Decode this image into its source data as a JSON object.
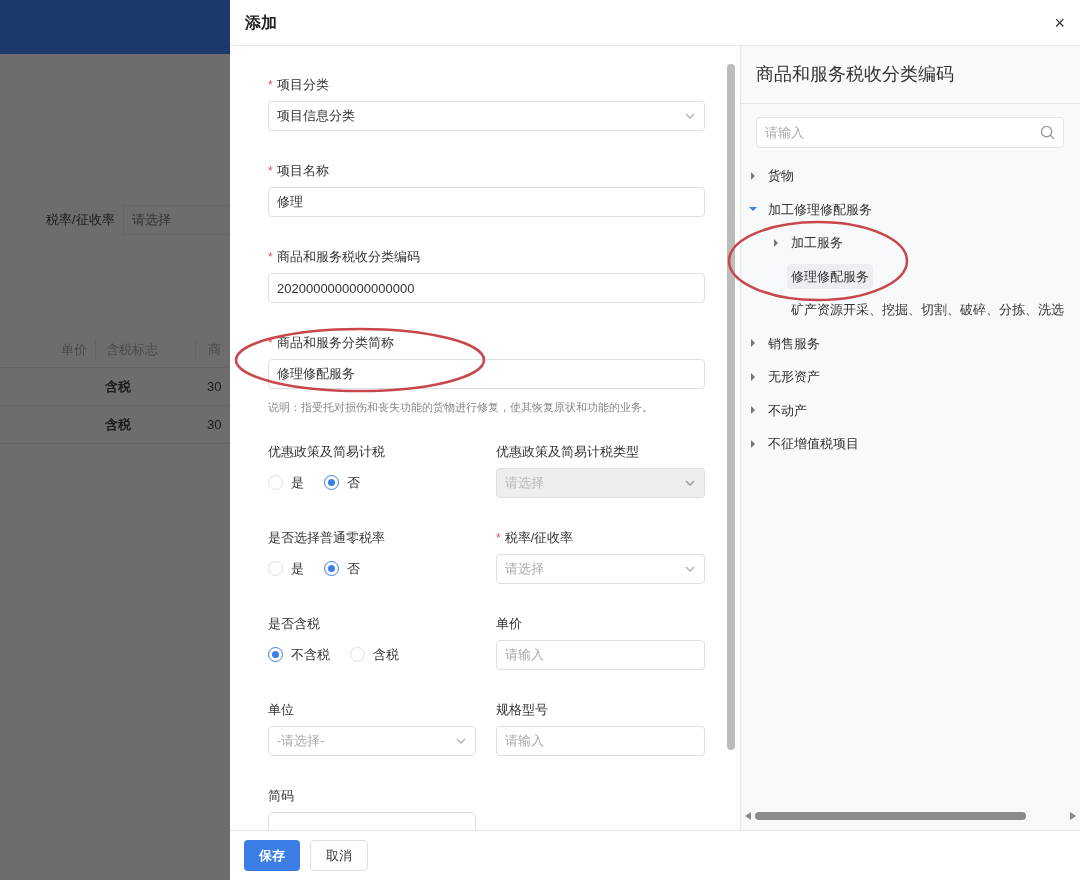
{
  "background_page": {
    "filter": {
      "label": "税率/征收率",
      "placeholder": "请选择"
    },
    "table": {
      "columns": [
        "单价",
        "含税标志",
        "商"
      ],
      "rows": [
        {
          "tax_flag": "含税",
          "column_3": "30"
        },
        {
          "tax_flag": "含税",
          "column_3": "30"
        }
      ]
    }
  },
  "dialog": {
    "title": "添加",
    "close": "×",
    "form": {
      "fields": [
        {
          "kind": "select",
          "label": "项目分类",
          "required_mark": "*",
          "value": "项目信息分类"
        },
        {
          "kind": "input",
          "label": "项目名称",
          "required_mark": "*",
          "value": "修理"
        },
        {
          "kind": "input",
          "label": "商品和服务税收分类编码",
          "required_mark": "*",
          "value": "2020000000000000000"
        },
        {
          "kind": "input",
          "label": "商品和服务分类简称",
          "required_mark": "*",
          "value": "修理修配服务",
          "hint": "说明：指受托对损伤和丧失功能的货物进行修复，使其恢复原状和功能的业务。"
        }
      ],
      "grid": [
        {
          "kind": "radio",
          "label": "优惠政策及简易计税",
          "options": [
            {
              "label": "是",
              "selected": false
            },
            {
              "label": "否",
              "selected": true
            }
          ]
        },
        {
          "kind": "select",
          "label": "优惠政策及简易计税类型",
          "placeholder": "请选择",
          "disabled": true
        },
        {
          "kind": "radio",
          "label": "是否选择普通零税率",
          "options": [
            {
              "label": "是",
              "selected": false
            },
            {
              "label": "否",
              "selected": true
            }
          ]
        },
        {
          "kind": "select",
          "label": "税率/征收率",
          "required_mark": "*",
          "placeholder": "请选择",
          "disabled": false
        },
        {
          "kind": "radio",
          "label": "是否含税",
          "options": [
            {
              "label": "不含税",
              "selected": true
            },
            {
              "label": "含税",
              "selected": false
            }
          ]
        },
        {
          "kind": "input",
          "label": "单价",
          "placeholder": "请输入"
        },
        {
          "kind": "select",
          "label": "单位",
          "placeholder": "-请选择-",
          "disabled": false
        },
        {
          "kind": "input",
          "label": "规格型号",
          "placeholder": "请输入"
        },
        {
          "kind": "input",
          "label": "简码"
        }
      ]
    },
    "tax_code_panel": {
      "title": "商品和服务税收分类编码",
      "search": {
        "placeholder": "请输入"
      },
      "tree": [
        {
          "label": "货物",
          "expanded": false,
          "selected": false
        },
        {
          "label": "加工修理修配服务",
          "expanded": true,
          "selected": false,
          "children": [
            {
              "label": "加工服务",
              "expanded": false,
              "selected": false
            },
            {
              "label": "修理修配服务",
              "selected": true
            },
            {
              "label": "矿产资源开采、挖掘、切割、破碎、分拣、洗选",
              "selected": false
            }
          ]
        },
        {
          "label": "销售服务",
          "expanded": false,
          "selected": false
        },
        {
          "label": "无形资产",
          "expanded": false,
          "selected": false
        },
        {
          "label": "不动产",
          "expanded": false,
          "selected": false
        },
        {
          "label": "不征增值税项目",
          "expanded": false,
          "selected": false
        }
      ]
    },
    "buttons": [
      {
        "label": "保存",
        "kind": "primary"
      },
      {
        "label": "取消",
        "kind": "default"
      }
    ]
  }
}
